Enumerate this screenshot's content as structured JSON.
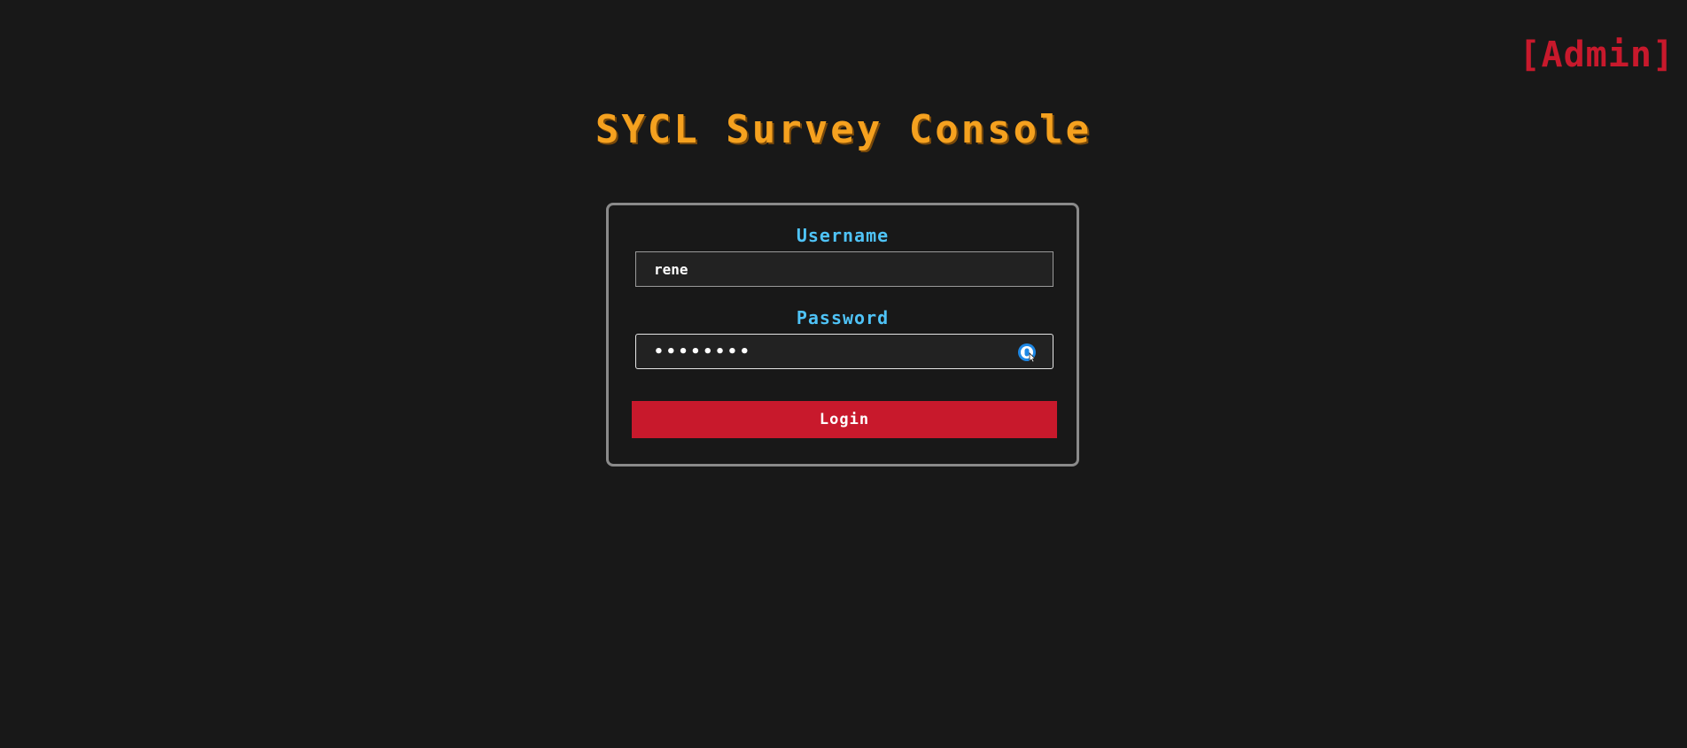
{
  "header": {
    "admin_link": "[Admin]"
  },
  "page": {
    "title": "SYCL Survey Console"
  },
  "login_form": {
    "username_label": "Username",
    "username_value": "rene",
    "password_label": "Password",
    "password_value": "••••••••",
    "password_manager_icon": "password-manager-icon",
    "login_label": "Login"
  },
  "colors": {
    "background": "#181818",
    "title": "#f5a11f",
    "label": "#4fc3f7",
    "accent": "#c8192c",
    "card_border": "#8a8a8a"
  }
}
